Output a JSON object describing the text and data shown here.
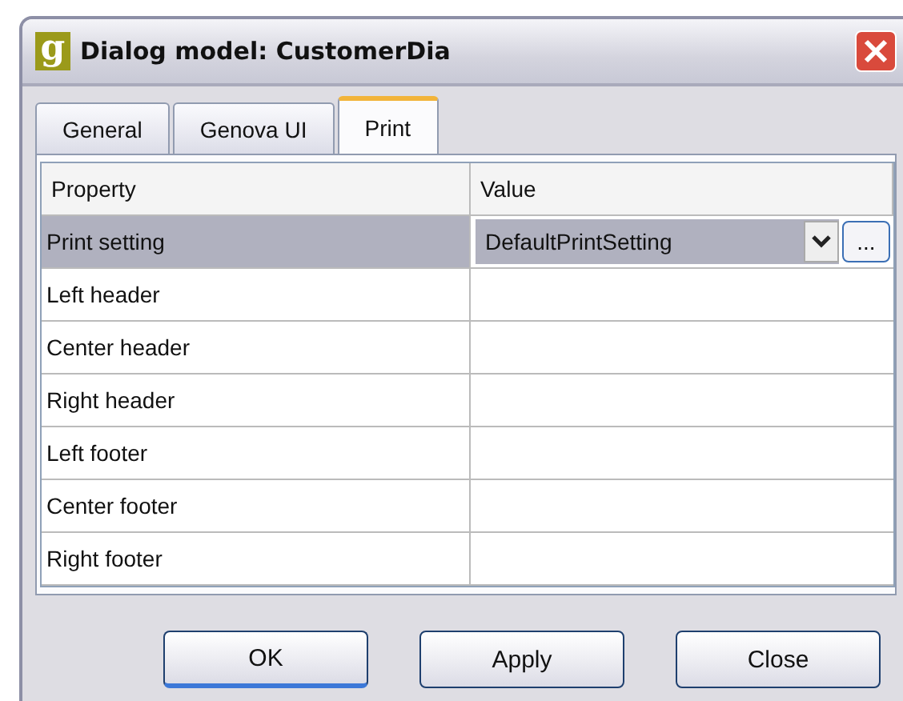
{
  "window": {
    "logo": "g",
    "title": "Dialog model: CustomerDia"
  },
  "tabs": [
    {
      "label": "General",
      "selected": false
    },
    {
      "label": "Genova UI",
      "selected": false
    },
    {
      "label": "Print",
      "selected": true
    }
  ],
  "table": {
    "columns": [
      "Property",
      "Value"
    ],
    "rows": [
      {
        "property": "Print setting",
        "value": "DefaultPrintSetting",
        "selected": true,
        "kind": "dropdown",
        "more": "..."
      },
      {
        "property": "Left header",
        "selected": false,
        "kind": "text"
      },
      {
        "property": "Center header",
        "selected": false,
        "kind": "text"
      },
      {
        "property": "Right header",
        "selected": false,
        "kind": "text"
      },
      {
        "property": "Left footer",
        "selected": false,
        "kind": "text"
      },
      {
        "property": "Center footer",
        "selected": false,
        "kind": "text"
      },
      {
        "property": "Right footer",
        "selected": false,
        "kind": "text"
      }
    ]
  },
  "buttons": [
    {
      "label": "OK",
      "default": true
    },
    {
      "label": "Apply",
      "default": false
    },
    {
      "label": "Close",
      "default": false
    }
  ]
}
